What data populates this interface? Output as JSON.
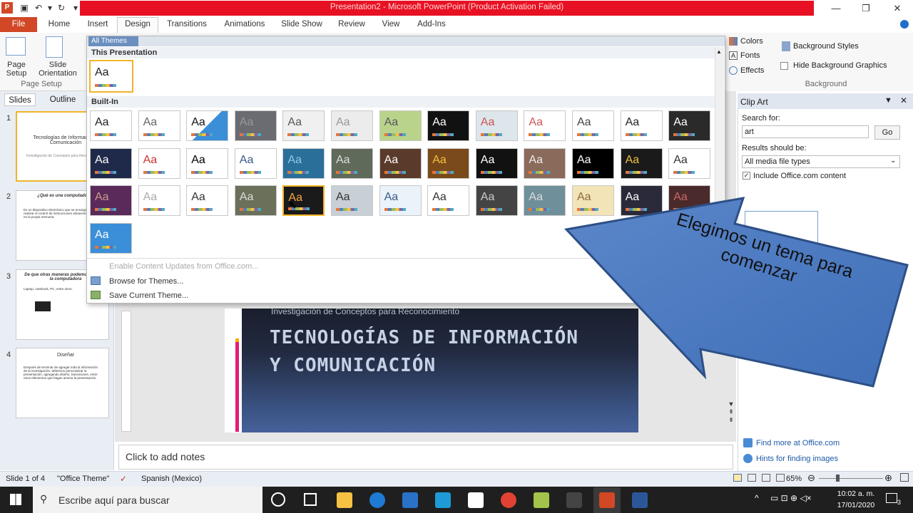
{
  "window": {
    "title": "Presentation2 - Microsoft PowerPoint (Product Activation Failed)"
  },
  "tabs": [
    "File",
    "Home",
    "Insert",
    "Design",
    "Transitions",
    "Animations",
    "Slide Show",
    "Review",
    "View",
    "Add-Ins"
  ],
  "ribbon": {
    "page_setup": "Page Setup",
    "slide_orientation": "Slide Orientation",
    "group_page_setup": "Page Setup",
    "colors": "Colors",
    "fonts": "Fonts",
    "effects": "Effects",
    "background_styles": "Background Styles",
    "hide_bg": "Hide Background Graphics",
    "group_background": "Background"
  },
  "themes": {
    "all_themes": "All Themes",
    "this_presentation": "This Presentation",
    "built_in": "Built-In",
    "sample": "Aa",
    "menu": [
      "Enable Content Updates from Office.com...",
      "Browse for Themes...",
      "Save Current Theme..."
    ]
  },
  "left_pane": {
    "tabs": [
      "Slides",
      "Outline"
    ],
    "slides": [
      {
        "num": "1",
        "title": "Tecnologías de Información y Comunicación",
        "sub": "Investigación de Conceptos para Reconocimiento"
      },
      {
        "num": "2",
        "title": "¿Qué es una computadora?",
        "sub": "Es un dispositivo electrónico que se encarga de realizar el control de instrucciones almacenadas en la propia memoria."
      },
      {
        "num": "3",
        "title": "De que otras maneras podemos llamar a la computadora",
        "sub": "Laptop, notebook, PC, entre otros."
      },
      {
        "num": "4",
        "title": "Diseñar",
        "sub": "Después de terminar de agregar toda la información de la investigación, debemos personalizar la presentación, agregando diseño, transiciones, entre otros elementos que hagan amena la presentación."
      }
    ]
  },
  "slide": {
    "subtitle": "Investigación de Conceptos para Reconocimiento",
    "title_line1": "TECNOLOGÍAS DE INFORMACIÓN",
    "title_line2": "Y COMUNICACIÓN"
  },
  "notes": "Click to add notes",
  "clip_art": {
    "title": "Clip Art",
    "search_label": "Search for:",
    "search_value": "art",
    "go": "Go",
    "results_label": "Results should be:",
    "results_value": "All media file types",
    "include": "Include Office.com content",
    "find_more": "Find more at Office.com",
    "hints": "Hints for finding images"
  },
  "callout": "Elegimos un tema para comenzar",
  "status": {
    "slide": "Slide 1 of 4",
    "theme": "\"Office Theme\"",
    "language": "Spanish (Mexico)",
    "zoom": "65%"
  },
  "taskbar": {
    "search": "Escribe aquí para buscar",
    "time": "10:02 a. m.",
    "date": "17/01/2020",
    "notifications": "3"
  }
}
